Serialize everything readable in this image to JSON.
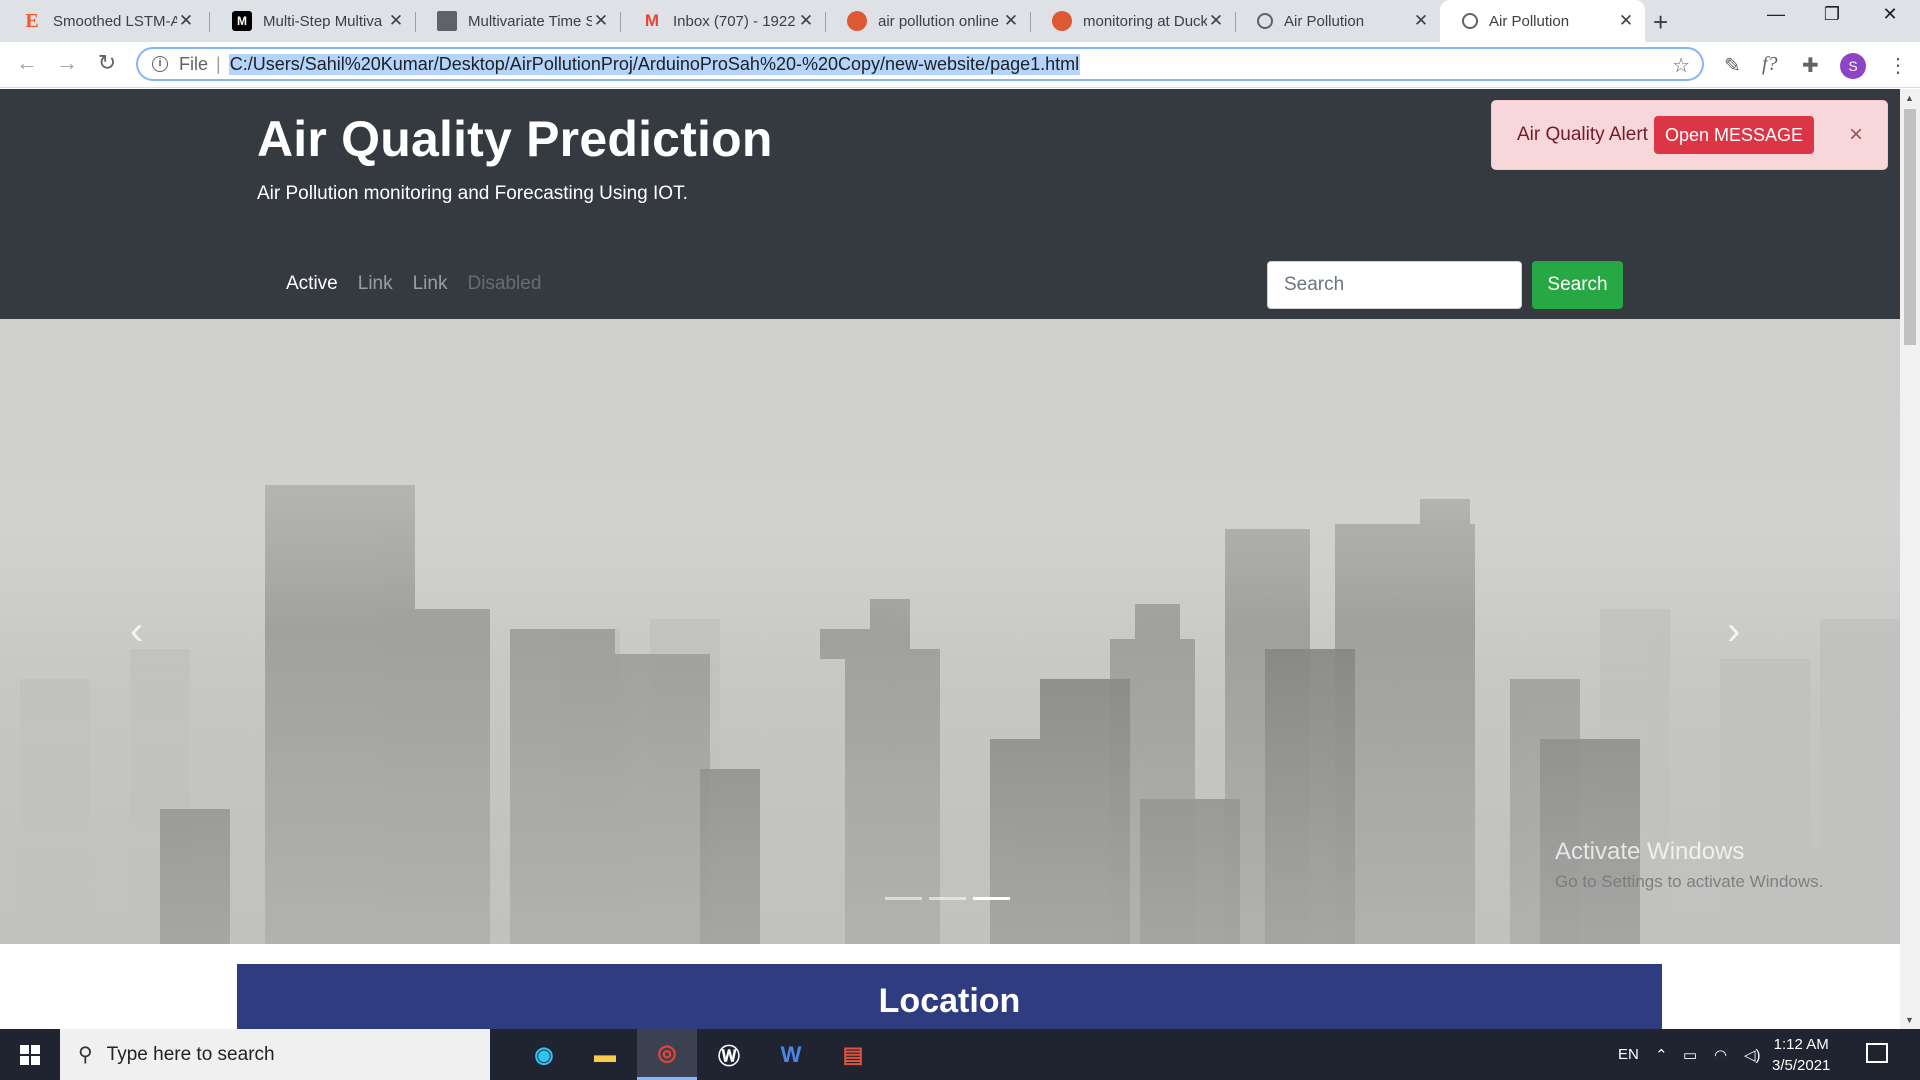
{
  "browser": {
    "tabs": [
      {
        "title": "Smoothed LSTM-A",
        "favicon": "E"
      },
      {
        "title": "Multi-Step Multiva",
        "favicon": "M"
      },
      {
        "title": "Multivariate Time S",
        "favicon": "doc"
      },
      {
        "title": "Inbox (707) - 1922",
        "favicon": "M"
      },
      {
        "title": "air pollution online",
        "favicon": "duck"
      },
      {
        "title": "monitoring at Duck",
        "favicon": "duck"
      },
      {
        "title": "Air Pollution",
        "favicon": "globe"
      },
      {
        "title": "Air Pollution",
        "favicon": "globe",
        "active": true
      }
    ],
    "new_tab": "+",
    "omnibox": {
      "scheme_label": "File",
      "url": "C:/Users/Sahil%20Kumar/Desktop/AirPollutionProj/ArduinoProSah%20-%20Copy/new-website/page1.html"
    },
    "profile_initial": "S",
    "window_controls": [
      "minimize",
      "restore",
      "close"
    ]
  },
  "page": {
    "header": {
      "title": "Air Quality Prediction",
      "subtitle": "Air Pollution monitoring and Forecasting Using IOT."
    },
    "nav": {
      "items": [
        {
          "label": "Active",
          "state": "active"
        },
        {
          "label": "Link",
          "state": "link"
        },
        {
          "label": "Link",
          "state": "link"
        },
        {
          "label": "Disabled",
          "state": "disabled"
        }
      ]
    },
    "search": {
      "placeholder": "Search",
      "button_label": "Search"
    },
    "alert": {
      "text": "Air Quality Alert",
      "button_label": "Open MESSAGE",
      "close_glyph": "×"
    },
    "carousel": {
      "image": "foggy-city-skyline",
      "slide_count": 3,
      "active_slide": 3
    },
    "location": {
      "title": "Location"
    },
    "watermark": {
      "line1": "Activate Windows",
      "line2": "Go to Settings to activate Windows."
    }
  },
  "taskbar": {
    "search_placeholder": "Type here to search",
    "apps": [
      "edge",
      "file-explorer",
      "chrome",
      "app-w",
      "word",
      "acrobat"
    ],
    "language": "EN",
    "time": "1:12 AM",
    "date": "3/5/2021"
  },
  "colors": {
    "header_bg": "#343a40",
    "search_button": "#28a745",
    "alert_bg": "#f8d7da",
    "alert_button": "#dc3545",
    "location_bg": "#2f3d80"
  }
}
